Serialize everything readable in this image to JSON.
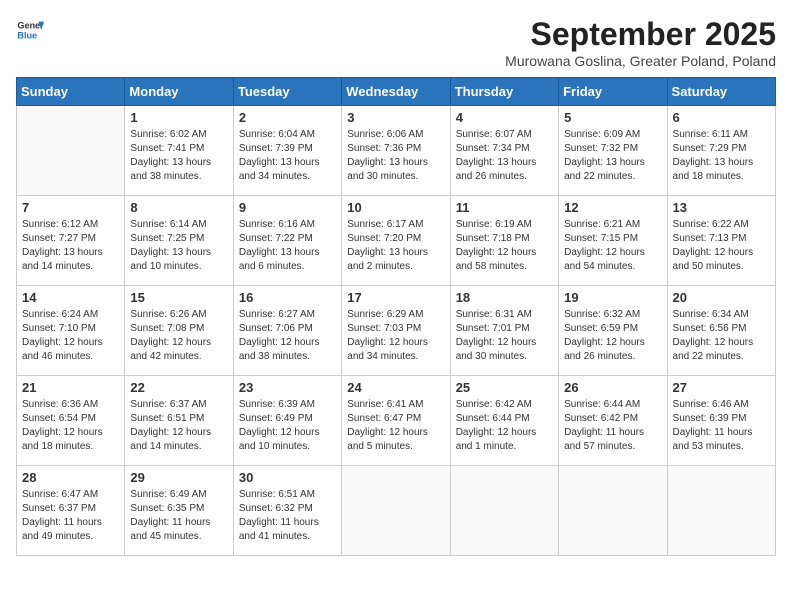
{
  "header": {
    "logo_line1": "General",
    "logo_line2": "Blue",
    "month_title": "September 2025",
    "subtitle": "Murowana Goslina, Greater Poland, Poland"
  },
  "weekdays": [
    "Sunday",
    "Monday",
    "Tuesday",
    "Wednesday",
    "Thursday",
    "Friday",
    "Saturday"
  ],
  "weeks": [
    [
      {
        "day": "",
        "empty": true
      },
      {
        "day": "1",
        "sunrise": "6:02 AM",
        "sunset": "7:41 PM",
        "daylight": "13 hours and 38 minutes."
      },
      {
        "day": "2",
        "sunrise": "6:04 AM",
        "sunset": "7:39 PM",
        "daylight": "13 hours and 34 minutes."
      },
      {
        "day": "3",
        "sunrise": "6:06 AM",
        "sunset": "7:36 PM",
        "daylight": "13 hours and 30 minutes."
      },
      {
        "day": "4",
        "sunrise": "6:07 AM",
        "sunset": "7:34 PM",
        "daylight": "13 hours and 26 minutes."
      },
      {
        "day": "5",
        "sunrise": "6:09 AM",
        "sunset": "7:32 PM",
        "daylight": "13 hours and 22 minutes."
      },
      {
        "day": "6",
        "sunrise": "6:11 AM",
        "sunset": "7:29 PM",
        "daylight": "13 hours and 18 minutes."
      }
    ],
    [
      {
        "day": "7",
        "sunrise": "6:12 AM",
        "sunset": "7:27 PM",
        "daylight": "13 hours and 14 minutes."
      },
      {
        "day": "8",
        "sunrise": "6:14 AM",
        "sunset": "7:25 PM",
        "daylight": "13 hours and 10 minutes."
      },
      {
        "day": "9",
        "sunrise": "6:16 AM",
        "sunset": "7:22 PM",
        "daylight": "13 hours and 6 minutes."
      },
      {
        "day": "10",
        "sunrise": "6:17 AM",
        "sunset": "7:20 PM",
        "daylight": "13 hours and 2 minutes."
      },
      {
        "day": "11",
        "sunrise": "6:19 AM",
        "sunset": "7:18 PM",
        "daylight": "12 hours and 58 minutes."
      },
      {
        "day": "12",
        "sunrise": "6:21 AM",
        "sunset": "7:15 PM",
        "daylight": "12 hours and 54 minutes."
      },
      {
        "day": "13",
        "sunrise": "6:22 AM",
        "sunset": "7:13 PM",
        "daylight": "12 hours and 50 minutes."
      }
    ],
    [
      {
        "day": "14",
        "sunrise": "6:24 AM",
        "sunset": "7:10 PM",
        "daylight": "12 hours and 46 minutes."
      },
      {
        "day": "15",
        "sunrise": "6:26 AM",
        "sunset": "7:08 PM",
        "daylight": "12 hours and 42 minutes."
      },
      {
        "day": "16",
        "sunrise": "6:27 AM",
        "sunset": "7:06 PM",
        "daylight": "12 hours and 38 minutes."
      },
      {
        "day": "17",
        "sunrise": "6:29 AM",
        "sunset": "7:03 PM",
        "daylight": "12 hours and 34 minutes."
      },
      {
        "day": "18",
        "sunrise": "6:31 AM",
        "sunset": "7:01 PM",
        "daylight": "12 hours and 30 minutes."
      },
      {
        "day": "19",
        "sunrise": "6:32 AM",
        "sunset": "6:59 PM",
        "daylight": "12 hours and 26 minutes."
      },
      {
        "day": "20",
        "sunrise": "6:34 AM",
        "sunset": "6:56 PM",
        "daylight": "12 hours and 22 minutes."
      }
    ],
    [
      {
        "day": "21",
        "sunrise": "6:36 AM",
        "sunset": "6:54 PM",
        "daylight": "12 hours and 18 minutes."
      },
      {
        "day": "22",
        "sunrise": "6:37 AM",
        "sunset": "6:51 PM",
        "daylight": "12 hours and 14 minutes."
      },
      {
        "day": "23",
        "sunrise": "6:39 AM",
        "sunset": "6:49 PM",
        "daylight": "12 hours and 10 minutes."
      },
      {
        "day": "24",
        "sunrise": "6:41 AM",
        "sunset": "6:47 PM",
        "daylight": "12 hours and 5 minutes."
      },
      {
        "day": "25",
        "sunrise": "6:42 AM",
        "sunset": "6:44 PM",
        "daylight": "12 hours and 1 minute."
      },
      {
        "day": "26",
        "sunrise": "6:44 AM",
        "sunset": "6:42 PM",
        "daylight": "11 hours and 57 minutes."
      },
      {
        "day": "27",
        "sunrise": "6:46 AM",
        "sunset": "6:39 PM",
        "daylight": "11 hours and 53 minutes."
      }
    ],
    [
      {
        "day": "28",
        "sunrise": "6:47 AM",
        "sunset": "6:37 PM",
        "daylight": "11 hours and 49 minutes."
      },
      {
        "day": "29",
        "sunrise": "6:49 AM",
        "sunset": "6:35 PM",
        "daylight": "11 hours and 45 minutes."
      },
      {
        "day": "30",
        "sunrise": "6:51 AM",
        "sunset": "6:32 PM",
        "daylight": "11 hours and 41 minutes."
      },
      {
        "day": "",
        "empty": true
      },
      {
        "day": "",
        "empty": true
      },
      {
        "day": "",
        "empty": true
      },
      {
        "day": "",
        "empty": true
      }
    ]
  ]
}
